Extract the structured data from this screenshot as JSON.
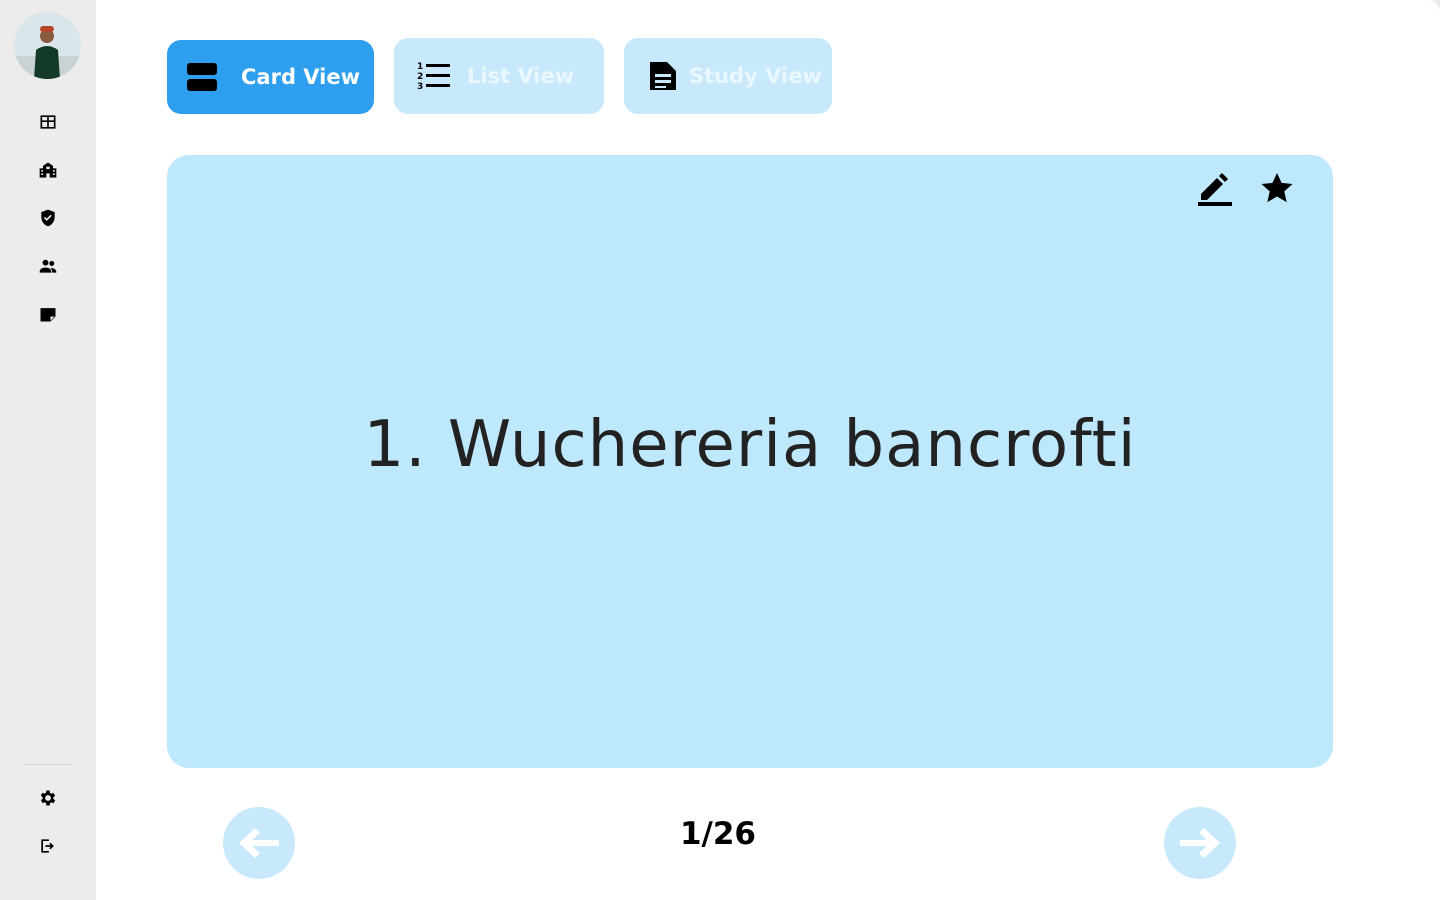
{
  "sidebar": {
    "avatar_alt": "",
    "nav_icons": [
      "dashboard-icon",
      "school-icon",
      "shield-icon",
      "group-icon",
      "note-icon"
    ],
    "bottom_icons": [
      "settings-icon",
      "logout-icon"
    ]
  },
  "view_tabs": {
    "card_view": "Card View",
    "list_view": "List View",
    "study_view": "Study View"
  },
  "card": {
    "term": "1. Wuchereria bancrofti"
  },
  "pager": {
    "counter": "1/26"
  },
  "colors": {
    "active_tab": "#2e9fef",
    "inactive_tab": "#c8e9fb",
    "card_bg": "#bee8fb",
    "sidebar_bg": "#ececec"
  }
}
